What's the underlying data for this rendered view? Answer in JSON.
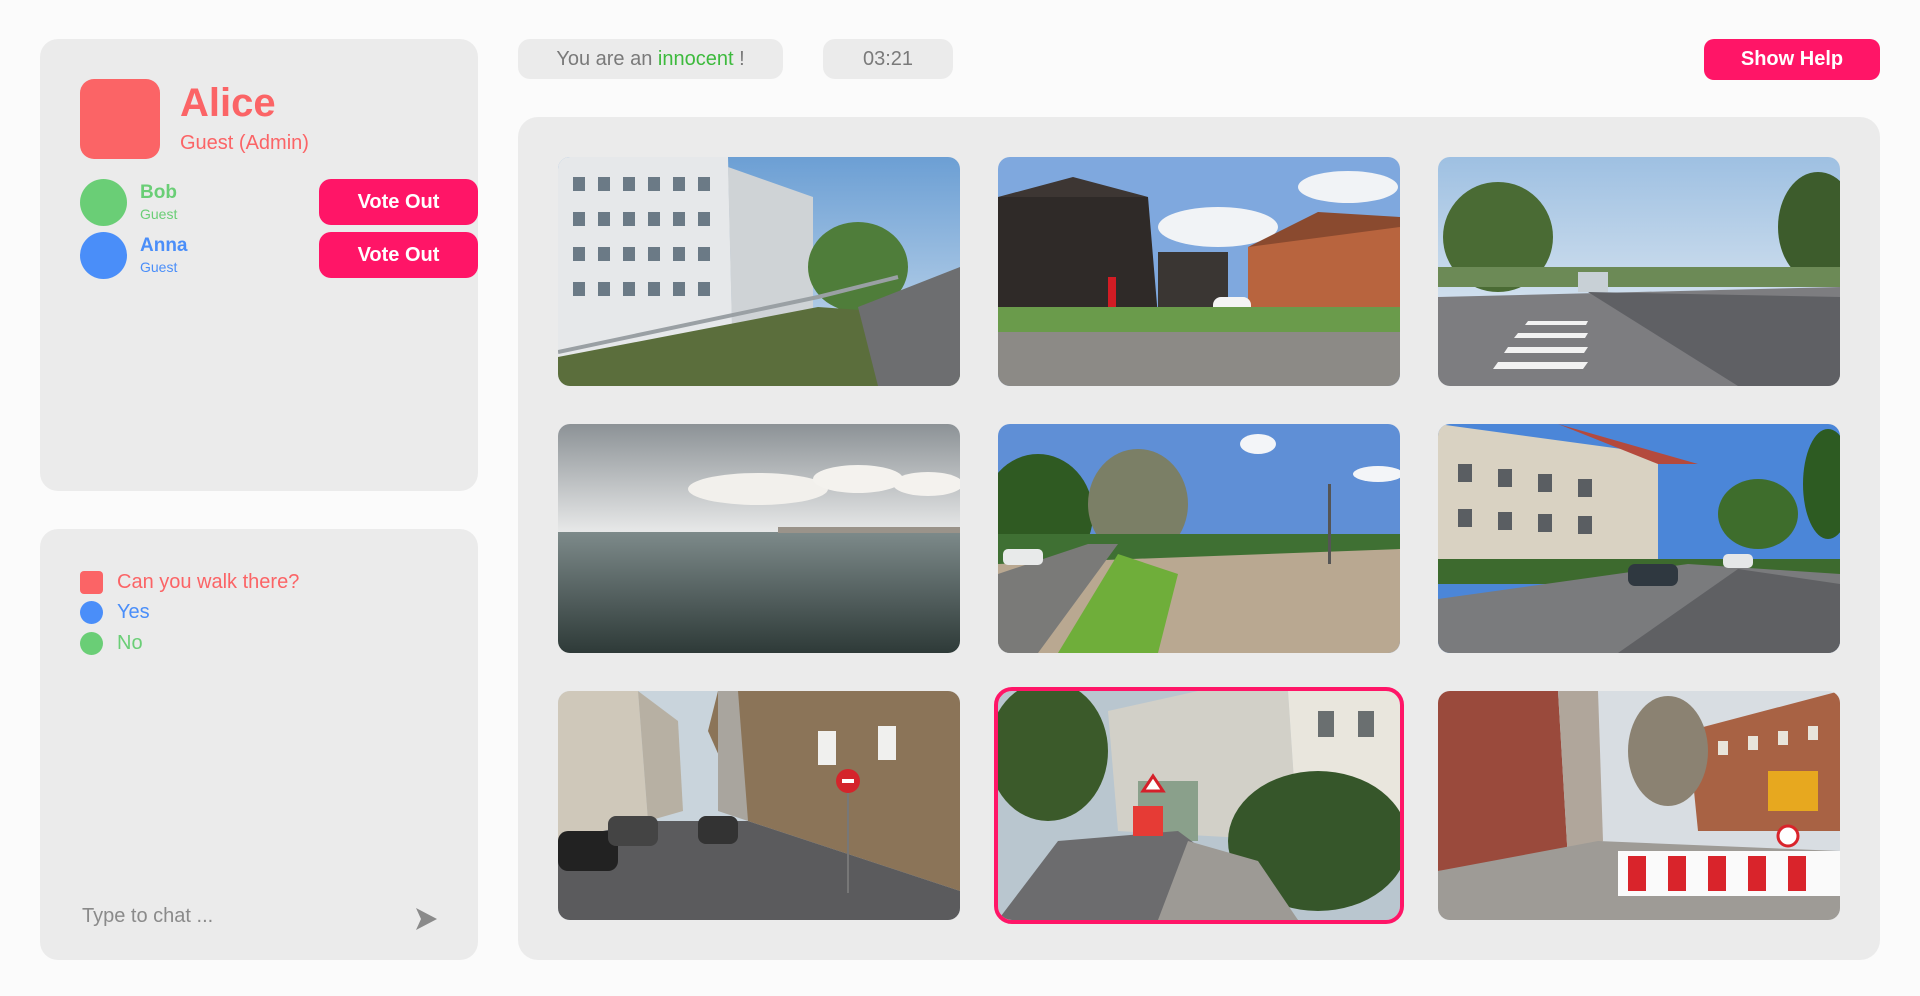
{
  "me": {
    "name": "Alice",
    "role": "Guest (Admin)",
    "color": "#fb6466"
  },
  "players": [
    {
      "name": "Bob",
      "role": "Guest",
      "color": "#6ace76",
      "vote_label": "Vote Out"
    },
    {
      "name": "Anna",
      "role": "Guest",
      "color": "#4a8ef9",
      "vote_label": "Vote Out"
    }
  ],
  "status": {
    "prefix": "You are an",
    "role_word": "innocent",
    "suffix": "!",
    "role_color": "#3dba3d",
    "timer": "03:21"
  },
  "help_button": "Show Help",
  "chat": {
    "messages": [
      {
        "text": "Can you walk there?",
        "color": "#fb6466",
        "shape": "square"
      },
      {
        "text": "Yes",
        "color": "#4a8ef9",
        "shape": "circle"
      },
      {
        "text": "No",
        "color": "#6ace76",
        "shape": "circle"
      }
    ],
    "placeholder": "Type to chat ...",
    "send_icon": "send-arrow-icon"
  },
  "gallery": {
    "selected_index": 7,
    "accent": "#ff1567",
    "images": [
      "apartment blocks beside elevated walkway",
      "dark wooden house and brick houses",
      "road with zebra crossing",
      "open sea under clouds",
      "country road and empty field",
      "residential street with parked cars",
      "narrow street with stone building",
      "street with construction barriers and bushes",
      "street corner with construction site"
    ]
  }
}
